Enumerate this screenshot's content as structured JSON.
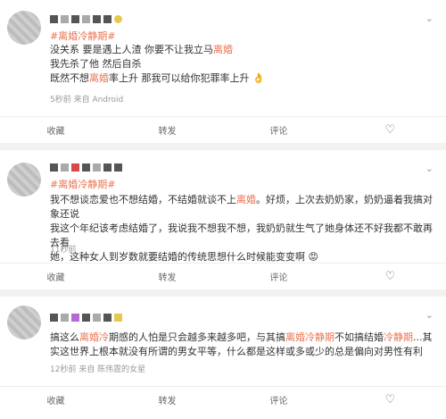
{
  "posts": [
    {
      "topic": "#离婚冷静期#",
      "lines": [
        [
          "没关系 要是遇上人渣 你要不让我立马",
          {
            "hl": "离婚"
          }
        ],
        [
          "我先杀了他 然后自杀"
        ],
        [
          "既然不想",
          {
            "hl": "离婚"
          },
          "率上升 那我可以给你犯罪率上升 👌"
        ]
      ],
      "meta": "5秒前 来自 Android"
    },
    {
      "topic": "#离婚冷静期#",
      "lines": [
        [
          "我不想谈恋爱也不想结婚，不结婚就谈不上",
          {
            "hl": "离婚"
          },
          "。好烦，上次去奶奶家，奶奶逼着我搞对象还说"
        ],
        [
          "我这个年纪该考虑结婚了，我说我不想我不想，我奶奶就生气了她身体还不好我都不敢再去看"
        ],
        [
          "她，这种女人到岁数就要结婚的传统思想什么时候能变变啊 😡"
        ]
      ],
      "meta": "11秒前"
    },
    {
      "topic": "",
      "lines": [
        [
          "搞这么",
          {
            "hl": "离婚冷"
          },
          "期感的人怕是只会越多来越多吧，与其搞",
          {
            "hl": "离婚冷静期"
          },
          "不如搞结婚",
          {
            "hl": "冷静期"
          },
          "...其"
        ],
        [
          "实这世界上根本就没有所谓的男女平等，什么都是这样或多或少的总是偏向对男性有利"
        ]
      ],
      "meta": "12秒前 来自 陈伟霆的女星"
    }
  ],
  "actions": {
    "favorite": "收藏",
    "repost": "转发",
    "comment": "评论",
    "like_icon": "heart-outline-icon"
  },
  "colors": {
    "highlight": "#eb7350",
    "separator": "#f2f2f2"
  }
}
